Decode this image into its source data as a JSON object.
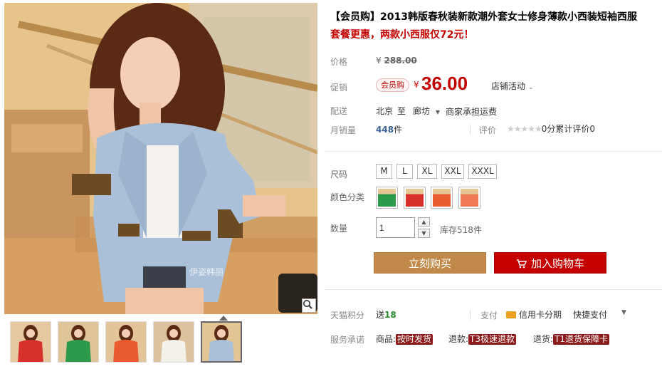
{
  "product": {
    "title": "【会员购】2013韩版春秋装新款潮外套女士修身薄款小西装短袖西服",
    "subtitle": "套餐更惠，两款小西服仅72元！"
  },
  "gallery": {
    "watermark": "伊姿韩丽",
    "zoom_icon": "magnifier-icon",
    "thumbnails": [
      "red",
      "green",
      "orange",
      "white",
      "blue"
    ]
  },
  "price": {
    "label": "价格",
    "currency": "¥",
    "original": "288.00"
  },
  "promo": {
    "label": "促销",
    "tag": "会员购",
    "currency": "¥",
    "price": "36.00",
    "store_activity": "店铺活动",
    "dropdown_icon": "chevron-down-icon"
  },
  "shipping": {
    "label": "配送",
    "from": "北京",
    "to_word": "至",
    "destination": "廊坊",
    "note": "商家承担运费"
  },
  "sales": {
    "label": "月销量",
    "count": "448",
    "unit": "件",
    "rating_label": "评价",
    "stars": "★★★★★",
    "rating_text": "0分累计评价0"
  },
  "size": {
    "label": "尺码",
    "options": [
      "M",
      "L",
      "XL",
      "XXL",
      "XXXL"
    ]
  },
  "color": {
    "label": "颜色分类",
    "swatches": [
      "green",
      "red",
      "orange",
      "coral"
    ]
  },
  "quantity": {
    "label": "数量",
    "value": "1",
    "stock": "库存518件"
  },
  "actions": {
    "buy": "立刻购买",
    "cart": "加入购物车",
    "cart_icon": "cart-icon"
  },
  "points": {
    "label": "天猫积分",
    "prefix": "送",
    "value": "18",
    "pay_label": "支付",
    "credit_card": "信用卡分期",
    "quick_pay": "快捷支付"
  },
  "service": {
    "label": "服务承诺",
    "items": [
      {
        "prefix": "商品:",
        "badge": "按时发货"
      },
      {
        "prefix": "退款:",
        "badge": "T3极速退款"
      },
      {
        "prefix": "退货:",
        "badge": "T1退货保障卡"
      }
    ]
  },
  "colors": {
    "accent_red": "#c40000",
    "buy_button": "#c28a4a"
  }
}
